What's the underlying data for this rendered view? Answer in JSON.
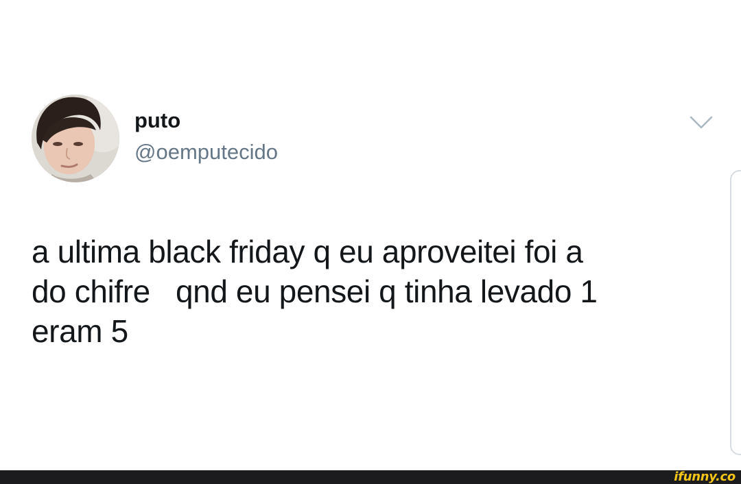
{
  "tweet": {
    "author": {
      "display_name": "puto",
      "handle": "@oemputecido",
      "avatar_icon": "user-avatar-photo"
    },
    "menu_icon": "chevron-down-icon",
    "text_lines": [
      "a ultima black friday q eu aproveitei foi a",
      "do chifre   qnd eu pensei q tinha levado 1",
      "eram 5"
    ]
  },
  "footer": {
    "watermark": "ifunny.co",
    "accent_color": "#f5c518"
  },
  "colors": {
    "text": "#14171a",
    "secondary_text": "#657786",
    "chevron": "#aab8c2",
    "background": "#ffffff"
  }
}
